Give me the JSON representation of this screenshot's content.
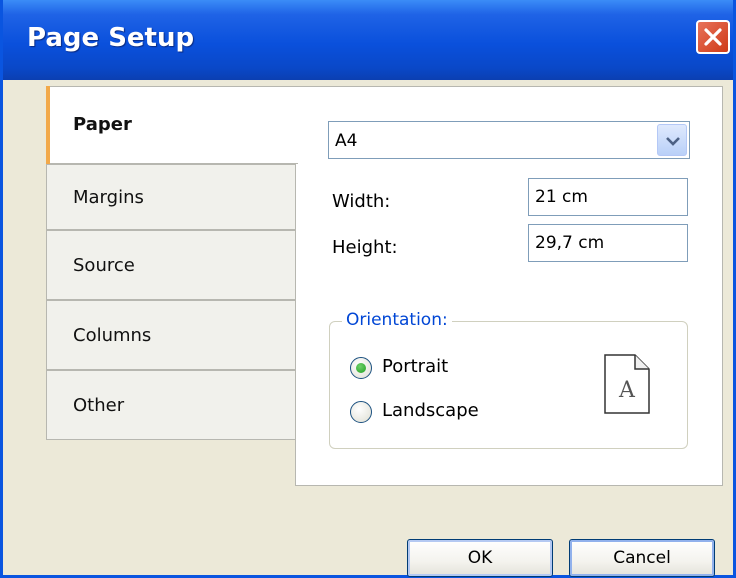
{
  "window": {
    "title": "Page Setup"
  },
  "tabs": [
    {
      "label": "Paper",
      "active": true
    },
    {
      "label": "Margins",
      "active": false
    },
    {
      "label": "Source",
      "active": false
    },
    {
      "label": "Columns",
      "active": false
    },
    {
      "label": "Other",
      "active": false
    }
  ],
  "paper": {
    "size_selected": "A4",
    "width_label": "Width:",
    "width_value": "21 cm",
    "height_label": "Height:",
    "height_value": "29,7 cm"
  },
  "orientation": {
    "legend": "Orientation:",
    "options": [
      {
        "label": "Portrait",
        "checked": true
      },
      {
        "label": "Landscape",
        "checked": false
      }
    ],
    "preview_letter": "A"
  },
  "buttons": {
    "ok": "OK",
    "cancel": "Cancel"
  },
  "colors": {
    "title_bar": "#0a50dc",
    "close_button": "#cf3a17",
    "active_tab_accent": "#f2a94a",
    "group_legend": "#0046d5"
  }
}
